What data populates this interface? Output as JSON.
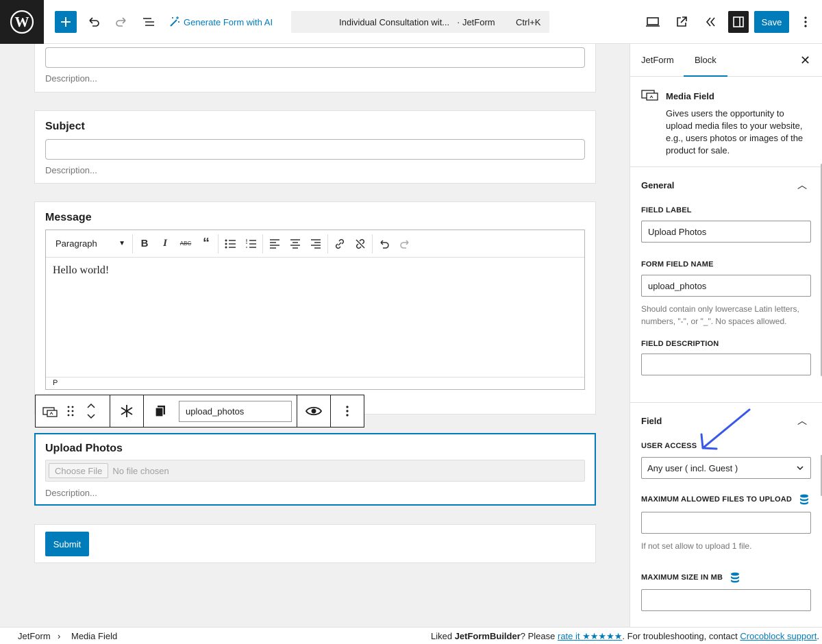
{
  "toolbar": {
    "generate_ai_label": "Generate Form with AI",
    "doc_title": "Individual Consultation wit...",
    "doc_type": "· JetForm",
    "shortcut": "Ctrl+K",
    "save_label": "Save"
  },
  "canvas": {
    "first_field": {
      "description": "Description..."
    },
    "subject_field": {
      "label": "Subject",
      "description": "Description..."
    },
    "message_field": {
      "label": "Message",
      "format_select": "Paragraph",
      "content": "Hello world!",
      "status_path": "P"
    },
    "block_toolbar": {
      "field_name_value": "upload_photos"
    },
    "upload_field": {
      "label": "Upload Photos",
      "choose_file": "Choose File",
      "no_file": "No file chosen",
      "description": "Description..."
    },
    "submit_label": "Submit"
  },
  "panel": {
    "tabs": [
      {
        "label": "JetForm"
      },
      {
        "label": "Block",
        "active": true
      }
    ],
    "block": {
      "title": "Media Field",
      "description": "Gives users the opportunity to upload media files to your website, e.g., users photos or images of the product for sale."
    },
    "general": {
      "heading": "General",
      "field_label_label": "FIELD LABEL",
      "field_label_value": "Upload Photos",
      "field_name_label": "FORM FIELD NAME",
      "field_name_value": "upload_photos",
      "field_name_help": "Should contain only lowercase Latin letters, numbers, \"-\", or \"_\". No spaces allowed.",
      "field_desc_label": "FIELD DESCRIPTION",
      "field_desc_value": ""
    },
    "field": {
      "heading": "Field",
      "user_access_label": "USER ACCESS",
      "user_access_value": "Any user ( incl. Guest )",
      "max_files_label": "MAXIMUM ALLOWED FILES TO UPLOAD",
      "max_files_value": "",
      "max_files_help": "If not set allow to upload 1 file.",
      "max_size_label": "MAXIMUM SIZE IN MB",
      "max_size_value": ""
    }
  },
  "footer": {
    "crumb_root": "JetForm",
    "crumb_current": "Media Field",
    "note_prefix": "Liked ",
    "note_brand": "JetFormBuilder",
    "note_mid": "? Please ",
    "rate_link": "rate it ★★★★★",
    "note_suffix": ". For troubleshooting, contact ",
    "support_link": "Crocoblock support",
    "note_end": "."
  },
  "colors": {
    "accent": "#007cba",
    "arrow": "#3858e9"
  }
}
